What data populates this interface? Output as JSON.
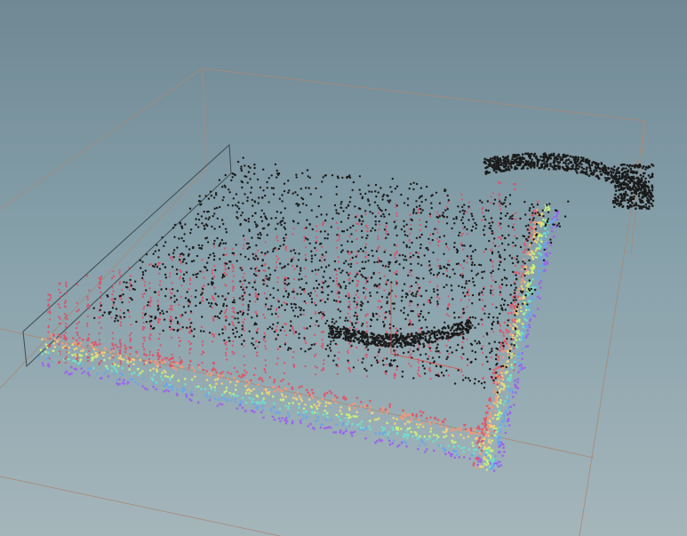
{
  "viewport": {
    "background_top": "#6f8894",
    "background_bottom": "#a5b6bb",
    "bbox_color": "#a88a78",
    "frame_color": "#3e4a50"
  },
  "point_cloud": {
    "scattered_points_color": "#1b1b1b",
    "ramp_colors": [
      "#9a66ea",
      "#66a8ee",
      "#6ee0cc",
      "#c8ee7a",
      "#eed07a",
      "#ee9a7a",
      "#dd5a6a"
    ],
    "guide_line_color": "#e0483c"
  }
}
